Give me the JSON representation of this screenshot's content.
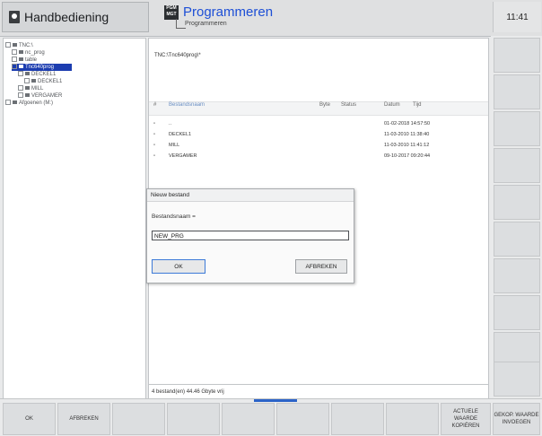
{
  "header": {
    "left_mode": "Handbediening",
    "right_mode": "Programmeren",
    "right_sub": "Programmeren",
    "prog_icon_text": "PGM MGT",
    "clock": "11:41"
  },
  "tree": [
    {
      "label": "TNC:\\",
      "selected": false
    },
    {
      "label": "nc_prog",
      "selected": false
    },
    {
      "label": "table",
      "selected": false
    },
    {
      "label": "Tnc640prog",
      "selected": true
    },
    {
      "label": "DECKEL1",
      "selected": false
    },
    {
      "label": "DECKEL1",
      "selected": false
    },
    {
      "label": "MILL",
      "selected": false
    },
    {
      "label": "VERGAMER",
      "selected": false
    },
    {
      "label": "Afgoenen (M:)",
      "selected": false
    }
  ],
  "files": {
    "path": "TNC:\\Tnc640prog\\*",
    "headers": [
      "Bestandsnaam",
      "Byte",
      "Status",
      "Datum",
      "Tijd"
    ],
    "rows": [
      {
        "name": "..",
        "date": "01-02-2018 14:57:50"
      },
      {
        "name": "DECKEL1",
        "date": "11-03-2010 11:38:40"
      },
      {
        "name": "MILL",
        "date": "11-03-2010 11:41:12"
      },
      {
        "name": "VERGAMER",
        "date": "09-10-2017 09:20:44"
      }
    ],
    "status": "4 bestand(en) 44.46 Gbyte vrij"
  },
  "dialog": {
    "title": "Nieuw bestand",
    "label": "Bestandsnaam =",
    "value": "NEW_PRG",
    "ok": "OK",
    "cancel": "AFBREKEN"
  },
  "softkeys": {
    "k1": "OK",
    "k2": "AFBREKEN",
    "k9": "ACTUELE WAARDE KOPIËREN",
    "k10": "GEKOP. WAARDE INVOEGEN"
  }
}
